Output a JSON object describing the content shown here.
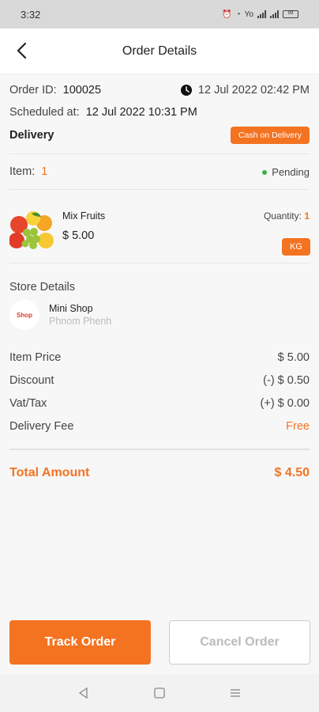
{
  "status_bar": {
    "time": "3:32",
    "network": "Yo",
    "battery": "99"
  },
  "header": {
    "title": "Order Details"
  },
  "order": {
    "id_label": "Order ID:",
    "id_value": "100025",
    "datetime": "12 Jul 2022 02:42 PM",
    "scheduled_label": "Scheduled at:",
    "scheduled_value": "12 Jul 2022 10:31 PM",
    "type": "Delivery",
    "payment_badge": "Cash on Delivery",
    "item_label": "Item:",
    "item_count": "1",
    "status": "Pending"
  },
  "product": {
    "name": "Mix Fruits",
    "price": "$ 5.00",
    "quantity_label": "Quantity:",
    "quantity_value": "1",
    "unit": "KG"
  },
  "store": {
    "section_title": "Store Details",
    "logo_text": "Shop",
    "name": "Mini Shop",
    "location": "Phnom Phenh"
  },
  "summary": {
    "item_price_label": "Item Price",
    "item_price_value": "$ 5.00",
    "discount_label": "Discount",
    "discount_value": "(-) $ 0.50",
    "vat_label": "Vat/Tax",
    "vat_value": "(+) $ 0.00",
    "delivery_label": "Delivery Fee",
    "delivery_value": "Free",
    "total_label": "Total Amount",
    "total_value": "$ 4.50"
  },
  "actions": {
    "track": "Track Order",
    "cancel": "Cancel Order"
  },
  "colors": {
    "accent": "#f47321",
    "pending": "#38b24a"
  }
}
